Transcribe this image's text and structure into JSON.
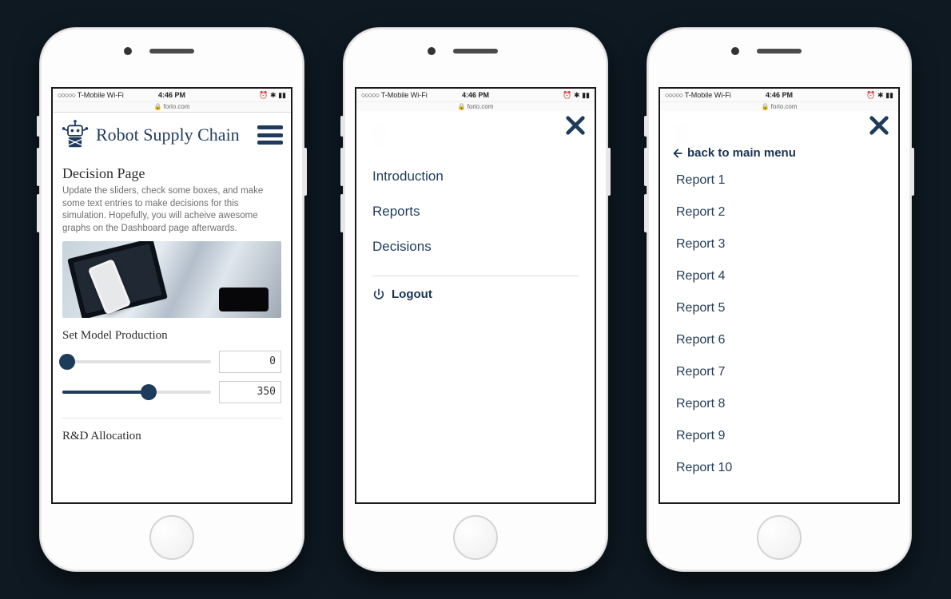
{
  "status": {
    "carrier": "T-Mobile Wi-Fi",
    "time": "4:46 PM",
    "url_label": "forio.com"
  },
  "header": {
    "title": "Robot Supply Chain"
  },
  "decision": {
    "page_title": "Decision Page",
    "page_desc": "Update the sliders, check some boxes, and make some text entries to make decisions for this simulation. Hopefully, you will acheive awesome graphs on the Dashboard page afterwards.",
    "section1_title": "Set Model Production",
    "slider1": {
      "value": "0",
      "pct": 0
    },
    "slider2": {
      "value": "350",
      "pct": 58
    },
    "section2_title": "R&D Allocation"
  },
  "main_menu": {
    "items": [
      "Introduction",
      "Reports",
      "Decisions"
    ],
    "logout": "Logout"
  },
  "sub_menu": {
    "back_label": "back to main menu",
    "items": [
      "Report 1",
      "Report 2",
      "Report 3",
      "Report 4",
      "Report 5",
      "Report 6",
      "Report 7",
      "Report 8",
      "Report 9",
      "Report 10"
    ]
  }
}
